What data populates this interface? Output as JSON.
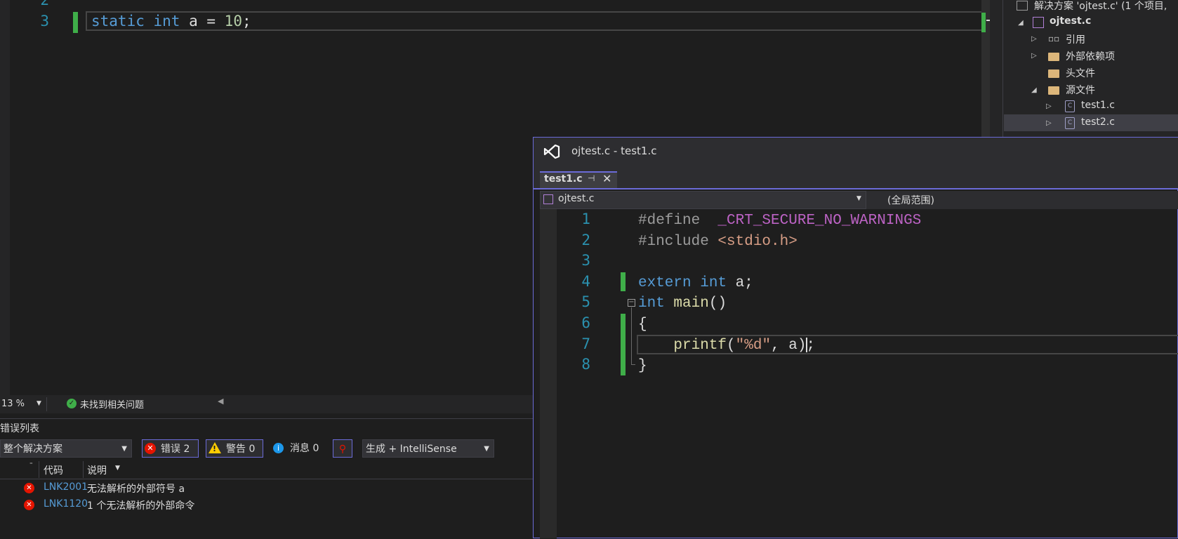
{
  "main_editor": {
    "line_numbers": [
      "2",
      "3"
    ],
    "code_tokens": [
      {
        "text": "static",
        "cls": "kw"
      },
      {
        "text": " ",
        "cls": "plain"
      },
      {
        "text": "int",
        "cls": "kw"
      },
      {
        "text": " a = ",
        "cls": "plain"
      },
      {
        "text": "10",
        "cls": "num"
      },
      {
        "text": ";",
        "cls": "plain"
      }
    ]
  },
  "status": {
    "zoom": "13 %",
    "issues": "未找到相关问题"
  },
  "error_list": {
    "title": "错误列表",
    "scope": "整个解决方案",
    "errors_label": "错误 2",
    "warnings_label": "警告 0",
    "messages_label": "消息 0",
    "build_filter": "生成 + IntelliSense",
    "columns": {
      "code": "代码",
      "description": "说明"
    },
    "rows": [
      {
        "code": "LNK2001",
        "description": "无法解析的外部符号 a"
      },
      {
        "code": "LNK1120",
        "description": "1 个无法解析的外部命令"
      }
    ]
  },
  "solution_explorer": {
    "solution": "解决方案 'ojtest.c' (1 个项目,",
    "project": "ojtest.c",
    "items": [
      {
        "label": "引用",
        "kind": "ref"
      },
      {
        "label": "外部依赖项",
        "kind": "folder"
      },
      {
        "label": "头文件",
        "kind": "folder"
      },
      {
        "label": "源文件",
        "kind": "folder"
      },
      {
        "label": "test1.c",
        "kind": "file"
      },
      {
        "label": "test2.c",
        "kind": "file"
      }
    ]
  },
  "float_window": {
    "title": "ojtest.c - test1.c",
    "tab_label": "test1.c",
    "nav_project": "ojtest.c",
    "nav_scope": "(全局范围)",
    "line_numbers": [
      "1",
      "2",
      "3",
      "4",
      "5",
      "6",
      "7",
      "8"
    ],
    "lines": [
      [
        {
          "text": "#define  ",
          "cls": "pp"
        },
        {
          "text": "_CRT_SECURE_NO_WARNINGS",
          "cls": "macro"
        }
      ],
      [
        {
          "text": "#include ",
          "cls": "pp"
        },
        {
          "text": "<stdio.h>",
          "cls": "str"
        }
      ],
      [],
      [
        {
          "text": "extern",
          "cls": "kw"
        },
        {
          "text": " ",
          "cls": "plain"
        },
        {
          "text": "int",
          "cls": "kw"
        },
        {
          "text": " a;",
          "cls": "plain"
        }
      ],
      [
        {
          "text": "int",
          "cls": "kw"
        },
        {
          "text": " ",
          "cls": "plain"
        },
        {
          "text": "main",
          "cls": "fn"
        },
        {
          "text": "()",
          "cls": "plain"
        }
      ],
      [
        {
          "text": "{",
          "cls": "plain"
        }
      ],
      [
        {
          "text": "    ",
          "cls": "plain"
        },
        {
          "text": "printf",
          "cls": "fn"
        },
        {
          "text": "(",
          "cls": "plain"
        },
        {
          "text": "\"%d\"",
          "cls": "str"
        },
        {
          "text": ", a);",
          "cls": "plain"
        }
      ],
      [
        {
          "text": "}",
          "cls": "plain"
        }
      ]
    ]
  },
  "colors": {
    "keyword": "#569cd6",
    "number": "#b5cea8",
    "string": "#d69d85",
    "function": "#dcdcaa",
    "preprocessor": "#9b9b9b",
    "macro": "#bd63c5",
    "line_number": "#2b91af",
    "change_bar": "#3fae49",
    "accent": "#6b6bd8",
    "error": "#e51400"
  }
}
